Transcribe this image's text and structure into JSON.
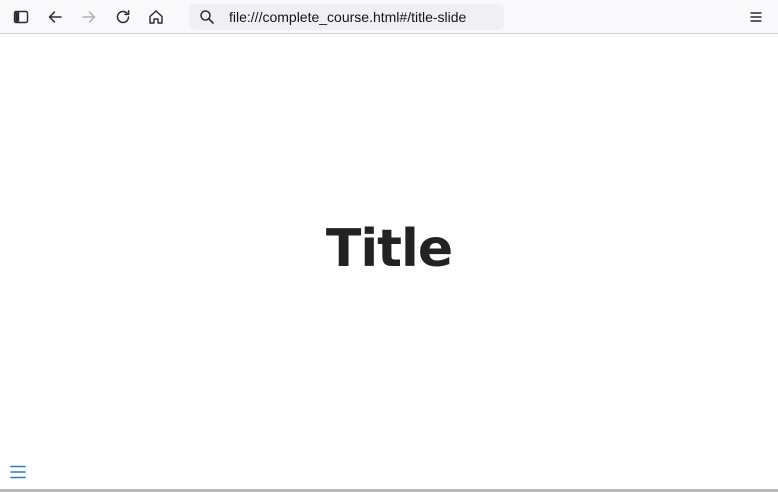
{
  "browser": {
    "url": "file:///complete_course.html#/title-slide",
    "buttons": {
      "sidebar": "sidebar-icon",
      "back": "arrow-left-icon",
      "forward": "arrow-right-icon",
      "reload": "reload-icon",
      "home": "home-icon",
      "menu": "hamburger-icon"
    },
    "forward_enabled": false
  },
  "slide": {
    "title": "Title"
  },
  "colors": {
    "toolbar_bg": "#f9f9fb",
    "urlbar_bg": "#f0f0f4",
    "title_text": "#222222",
    "menu_toggle": "#2a76dd"
  }
}
